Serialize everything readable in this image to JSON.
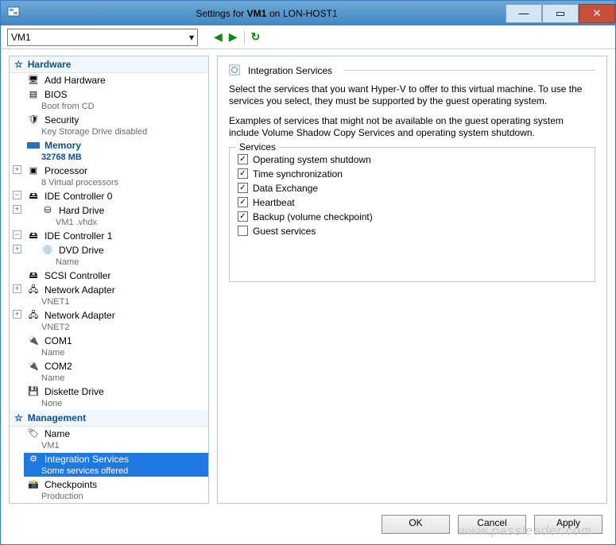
{
  "window": {
    "title_prefix": "Settings for",
    "vm": "VM1",
    "host_prefix": "on",
    "host": "LON-HOST1"
  },
  "toolbar": {
    "selected_vm": "VM1"
  },
  "hardware_header": "Hardware",
  "management_header": "Management",
  "tree": {
    "add_hardware": "Add Hardware",
    "bios": {
      "label": "BIOS",
      "sub": "Boot from CD"
    },
    "security": {
      "label": "Security",
      "sub": "Key Storage Drive disabled"
    },
    "memory": {
      "label": "Memory",
      "sub": "32768 MB"
    },
    "processor": {
      "label": "Processor",
      "sub": "8 Virtual processors"
    },
    "ide0": {
      "label": "IDE Controller  0"
    },
    "hard_drive": {
      "label": "Hard Drive",
      "sub": "VM1 .vhdx"
    },
    "ide1": {
      "label": "IDE Controller  1"
    },
    "dvd_drive": {
      "label": "DVD  Drive",
      "sub": "Name"
    },
    "scsi": {
      "label": "SCSI Controller"
    },
    "nic1": {
      "label": "Network  Adapter",
      "sub": "VNET1"
    },
    "nic2": {
      "label": "Network  Adapter",
      "sub": "VNET2"
    },
    "com1": {
      "label": "COM1",
      "sub": "Name"
    },
    "com2": {
      "label": "COM2",
      "sub": "Name"
    },
    "diskette": {
      "label": "Diskette Drive",
      "sub": "None"
    },
    "name": {
      "label": "Name",
      "sub": "VM1"
    },
    "integration": {
      "label": "Integration Services",
      "sub": "Some services offered"
    },
    "checkpoints": {
      "label": "Checkpoints",
      "sub": "Production"
    }
  },
  "panel": {
    "title": "Integration Services",
    "desc": "Select the services that you want Hyper-V to offer to this virtual machine. To use the services you select, they must be supported by the guest operating system.",
    "note": "Examples of services that might not be available on the guest operating system include Volume Shadow Copy Services and operating system shutdown.",
    "legend": "Services",
    "services": [
      {
        "label": "Operating system shutdown",
        "checked": true
      },
      {
        "label": "Time synchronization",
        "checked": true
      },
      {
        "label": "Data Exchange",
        "checked": true
      },
      {
        "label": "Heartbeat",
        "checked": true
      },
      {
        "label": "Backup (volume checkpoint)",
        "checked": true
      },
      {
        "label": "Guest services",
        "checked": false
      }
    ]
  },
  "buttons": {
    "ok": "OK",
    "cancel": "Cancel",
    "apply": "Apply"
  },
  "watermark": "www.passleader.com"
}
